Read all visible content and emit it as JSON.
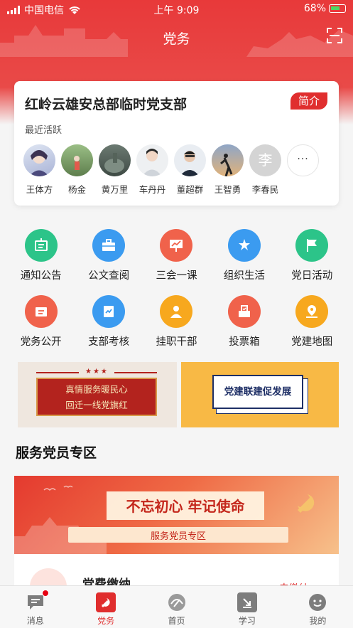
{
  "status_bar": {
    "carrier": "中国电信",
    "time": "上午 9:09",
    "battery": "68%"
  },
  "header": {
    "title": "党务",
    "scan_icon": "scan-icon"
  },
  "branch_card": {
    "title": "红岭云雄安总部临时党支部",
    "intro_button": "简介",
    "recent_label": "最近活跃",
    "members": [
      {
        "name": "王体方"
      },
      {
        "name": "杨金"
      },
      {
        "name": "黄万里"
      },
      {
        "name": "车丹丹"
      },
      {
        "name": "董超群"
      },
      {
        "name": "王智勇"
      },
      {
        "name": "李春民",
        "avatar_text": "李"
      }
    ],
    "more_label": "···"
  },
  "functions": [
    {
      "label": "通知公告",
      "icon": "notice-board-icon",
      "color": "#2cc489"
    },
    {
      "label": "公文查阅",
      "icon": "briefcase-icon",
      "color": "#3b9bf0"
    },
    {
      "label": "三会一课",
      "icon": "presentation-icon",
      "color": "#f0624b"
    },
    {
      "label": "组织生活",
      "icon": "star-house-icon",
      "color": "#3b9bf0"
    },
    {
      "label": "党日活动",
      "icon": "flag-icon",
      "color": "#2cc489"
    },
    {
      "label": "党务公开",
      "icon": "disclosure-icon",
      "color": "#f0624b"
    },
    {
      "label": "支部考核",
      "icon": "assessment-icon",
      "color": "#3b9bf0"
    },
    {
      "label": "挂职干部",
      "icon": "cadre-icon",
      "color": "#f7a81e"
    },
    {
      "label": "投票箱",
      "icon": "ballot-box-icon",
      "color": "#f0624b"
    },
    {
      "label": "党建地图",
      "icon": "map-pin-icon",
      "color": "#f7a81e"
    }
  ],
  "banners": {
    "left_line1": "真情服务暖民心",
    "left_line2": "回迁一线党旗红",
    "left_stars": "★★★",
    "right_text": "党建联建促发展"
  },
  "service_section": {
    "title": "服务党员专区",
    "slogan": "不忘初心 牢记使命",
    "sub_label": "服务党员专区"
  },
  "fee": {
    "title": "党费缴纳",
    "link": "去缴纳 >"
  },
  "tabbar": [
    {
      "label": "消息",
      "icon": "message-icon",
      "badge": true
    },
    {
      "label": "党务",
      "icon": "party-icon",
      "active": true
    },
    {
      "label": "首页",
      "icon": "home-logo-icon"
    },
    {
      "label": "学习",
      "icon": "study-icon"
    },
    {
      "label": "我的",
      "icon": "profile-icon"
    }
  ],
  "colors": {
    "brand_red": "#e02e2e",
    "header_red": "#e8393a"
  }
}
